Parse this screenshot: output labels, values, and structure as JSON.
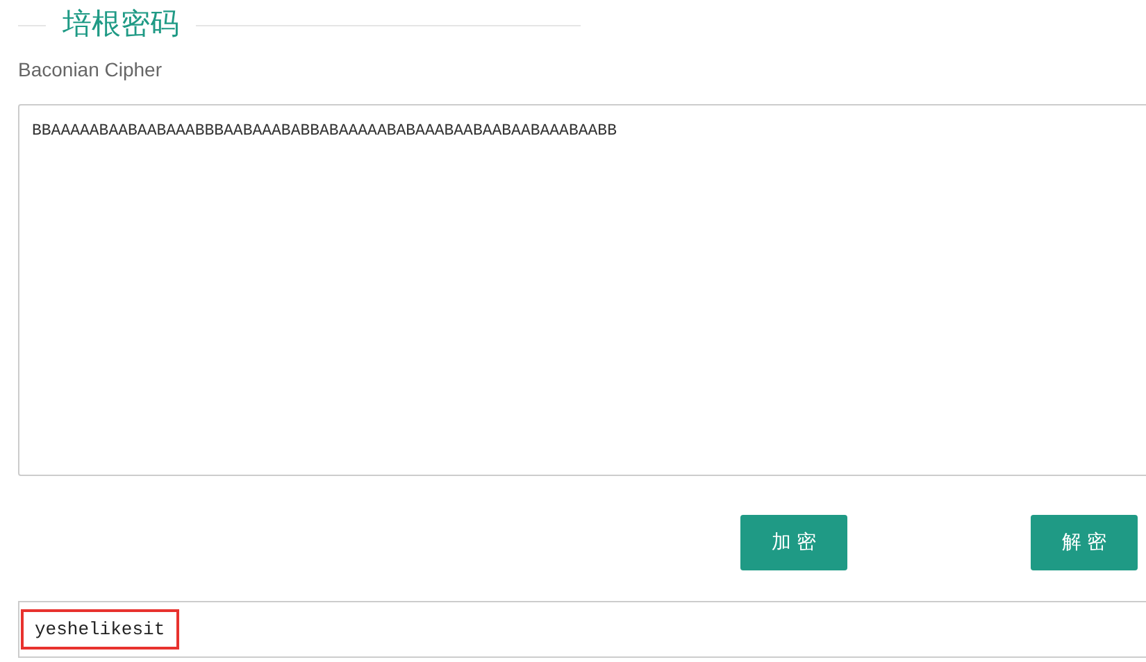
{
  "heading": {
    "title": "培根密码",
    "subtitle": "Baconian Cipher"
  },
  "input": {
    "value": "BBAAAAABAABAABAAABBBAABAAABABBABAAAAABABAAABAABAABAABAAABAABB"
  },
  "buttons": [
    {
      "label": "加 密"
    },
    {
      "label": "解 密"
    }
  ],
  "output": {
    "value": "yeshelikesit",
    "highlighted": true
  }
}
